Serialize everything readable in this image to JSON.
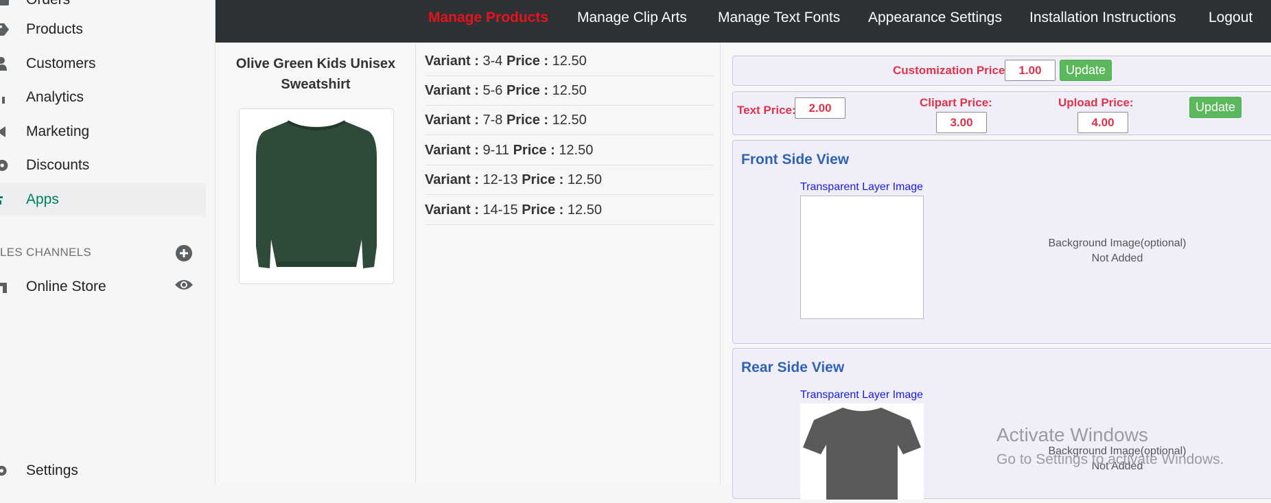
{
  "sidebar": {
    "items": [
      {
        "label": "Orders",
        "icon": "orders-icon"
      },
      {
        "label": "Products",
        "icon": "tag-icon"
      },
      {
        "label": "Customers",
        "icon": "person-icon"
      },
      {
        "label": "Analytics",
        "icon": "bar-chart-icon"
      },
      {
        "label": "Marketing",
        "icon": "megaphone-icon"
      },
      {
        "label": "Discounts",
        "icon": "discount-icon"
      },
      {
        "label": "Apps",
        "icon": "apps-icon"
      }
    ],
    "channels_heading": "LES CHANNELS",
    "online_store": "Online Store",
    "settings": "Settings"
  },
  "topnav": {
    "items": [
      "Manage Products",
      "Manage Clip Arts",
      "Manage Text Fonts",
      "Appearance Settings",
      "Installation Instructions",
      "Logout"
    ]
  },
  "product": {
    "title": "Olive Green Kids Unisex Sweatshirt",
    "color": "#2f4a38"
  },
  "variants": {
    "variant_label": "Variant :",
    "price_label": "Price :",
    "rows": [
      {
        "variant": "3-4",
        "price": "12.50"
      },
      {
        "variant": "5-6",
        "price": "12.50"
      },
      {
        "variant": "7-8",
        "price": "12.50"
      },
      {
        "variant": "9-11",
        "price": "12.50"
      },
      {
        "variant": "12-13",
        "price": "12.50"
      },
      {
        "variant": "14-15",
        "price": "12.50"
      }
    ]
  },
  "pricing": {
    "customization_label": "Customization Price:",
    "customization_value": "1.00",
    "update_label": "Update",
    "text_label": "Text Price:",
    "text_value": "2.00",
    "clipart_label": "Clipart Price:",
    "clipart_value": "3.00",
    "upload_label": "Upload Price:",
    "upload_value": "4.00"
  },
  "views": {
    "front_title": "Front Side View",
    "rear_title": "Rear Side View",
    "layer_label": "Transparent Layer Image",
    "bg_label": "Background Image(optional)",
    "bg_status": "Not Added"
  },
  "watermark": {
    "line1": "Activate Windows",
    "line2": "Go to Settings to activate Windows."
  },
  "colors": {
    "accent_green": "#008060",
    "topbar": "#2c3136",
    "active_nav": "#e8131a",
    "price_red": "#e0334a",
    "update_green": "#5cb85c",
    "view_title_blue": "#2f63b8"
  }
}
